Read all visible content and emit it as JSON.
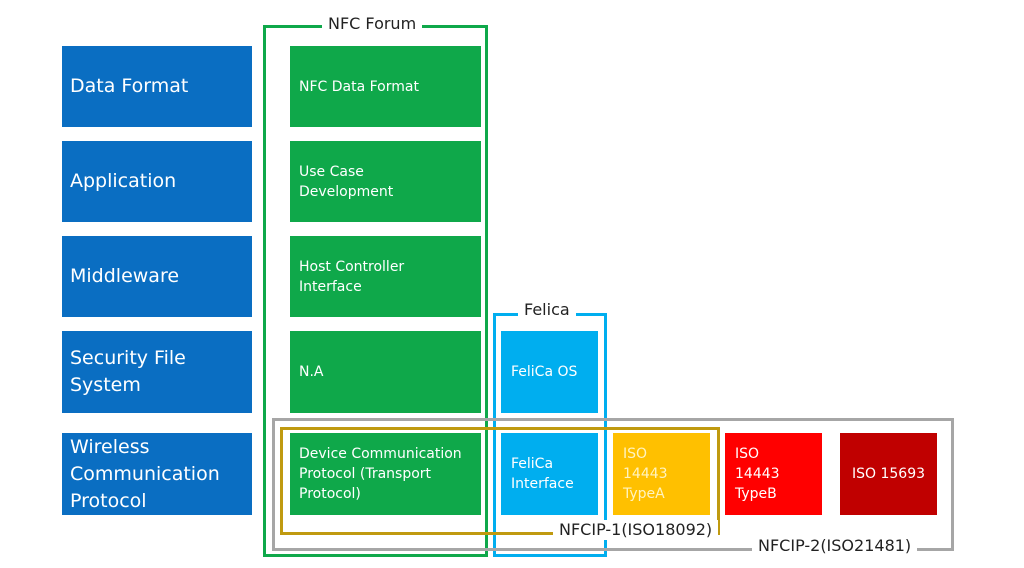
{
  "layers": [
    {
      "label": "Data Format"
    },
    {
      "label": "Application"
    },
    {
      "label": "Middleware"
    },
    {
      "label": "Security File System"
    },
    {
      "label": "Wireless Communication Protocol"
    }
  ],
  "groups": {
    "nfc_forum": {
      "label": "NFC Forum",
      "color": "#0fa84a"
    },
    "felica": {
      "label": "Felica",
      "color": "#00aeef"
    },
    "nfcip1": {
      "label": "NFCIP-1(ISO18092)",
      "color": "#c09a10"
    },
    "nfcip2": {
      "label": "NFCIP-2(ISO21481)",
      "color": "#a6a6a6"
    }
  },
  "nfc_forum_blocks": [
    {
      "label": "NFC Data Format"
    },
    {
      "label": "Use Case Development"
    },
    {
      "label": "Host Controller Interface"
    },
    {
      "label": "N.A"
    },
    {
      "label": "Device Communication Protocol (Transport Protocol)"
    }
  ],
  "felica_blocks": [
    {
      "label": "FeliCa OS"
    },
    {
      "label": "FeliCa Interface"
    }
  ],
  "iso_blocks": [
    {
      "label": "ISO 14443 TypeA",
      "color": "#ffc000"
    },
    {
      "label": "ISO 14443 TypeB",
      "color": "#ff0000"
    },
    {
      "label": "ISO 15693",
      "color": "#c00000"
    }
  ]
}
